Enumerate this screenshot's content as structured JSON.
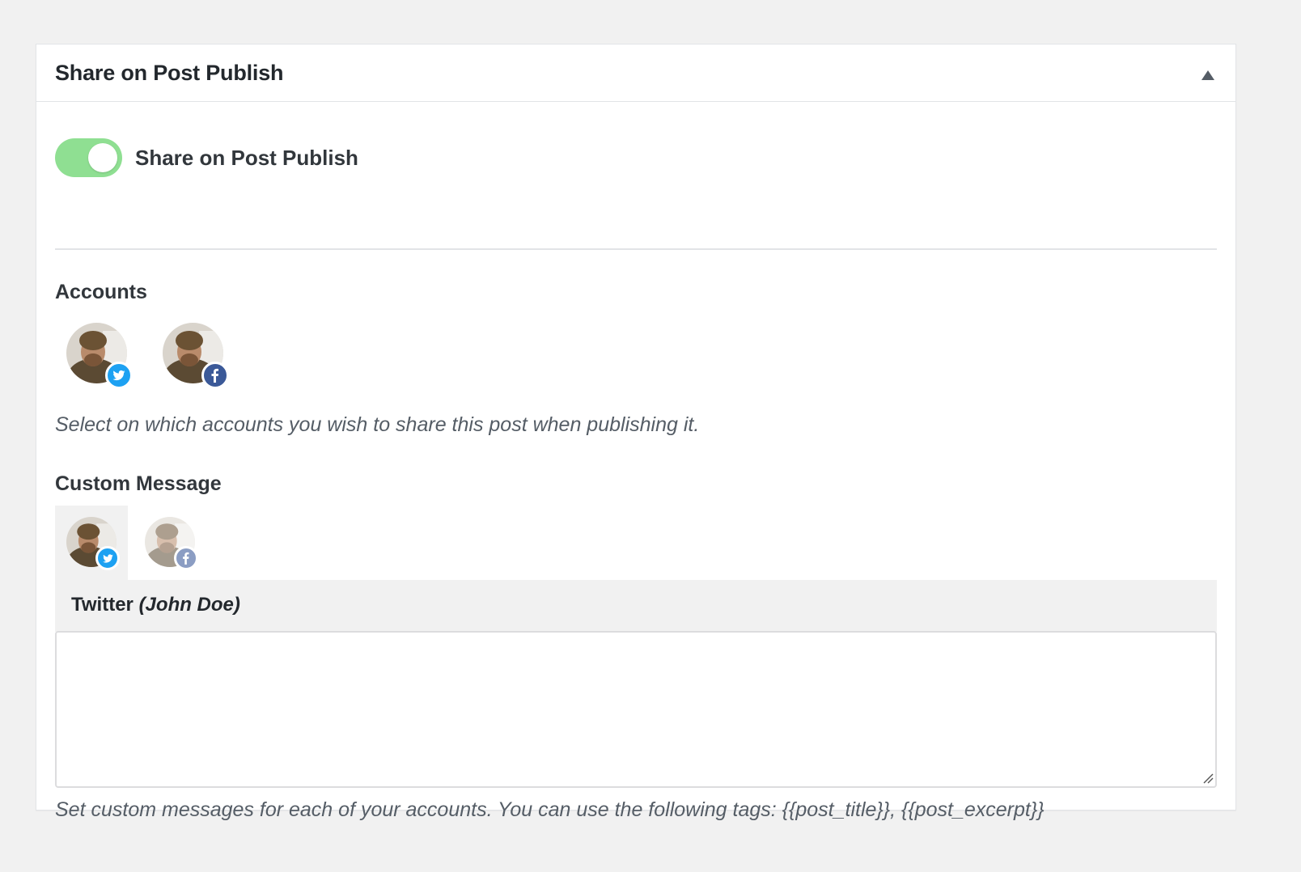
{
  "panel": {
    "title": "Share on Post Publish",
    "collapse_icon": "triangle-up-icon"
  },
  "toggle": {
    "label": "Share on Post Publish",
    "on": true,
    "color": "#8fdf92"
  },
  "accounts": {
    "title": "Accounts",
    "items": [
      {
        "network": "twitter",
        "icon": "twitter-icon",
        "badge_color": "#1da1f2"
      },
      {
        "network": "facebook",
        "icon": "facebook-icon",
        "badge_color": "#3b5998"
      }
    ],
    "help": "Select on which accounts you wish to share this post when publishing it."
  },
  "custom_message": {
    "title": "Custom Message",
    "tabs": [
      {
        "network": "twitter",
        "active": true
      },
      {
        "network": "facebook",
        "active": false
      }
    ],
    "active_network": "Twitter",
    "active_user": "(John Doe)",
    "message_value": "",
    "help": "Set custom messages for each of your accounts. You can use the following tags: {{post_title}}, {{post_excerpt}}"
  }
}
